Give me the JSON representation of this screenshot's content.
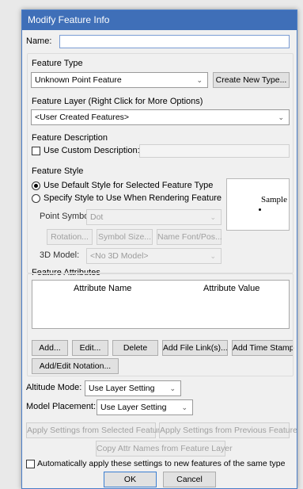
{
  "window": {
    "title": "Modify Feature Info"
  },
  "name": {
    "label": "Name:",
    "value": ""
  },
  "feature_type": {
    "heading": "Feature Type",
    "selected": "Unknown Point Feature",
    "create_button": "Create New Type..."
  },
  "feature_layer": {
    "heading": "Feature Layer (Right Click for More Options)",
    "selected": "<User Created Features>"
  },
  "feature_description": {
    "heading": "Feature Description",
    "checkbox_label": "Use Custom Description:",
    "value": ""
  },
  "feature_style": {
    "heading": "Feature Style",
    "radio_default": "Use Default Style for Selected Feature Type",
    "radio_specify": "Specify Style to Use When Rendering Feature",
    "point_symbol_label": "Point Symbol",
    "point_symbol_value": "Dot",
    "rotation_button": "Rotation...",
    "symbol_size_button": "Symbol Size...",
    "name_font_button": "Name Font/Pos...",
    "model_label": "3D Model:",
    "model_value": "<No 3D Model>",
    "sample_label": "Sample"
  },
  "feature_attributes": {
    "heading": "Feature Attributes",
    "columns": [
      "Attribute Name",
      "Attribute Value"
    ],
    "add_button": "Add...",
    "edit_button": "Edit...",
    "delete_button": "Delete",
    "file_link_button": "Add File Link(s)...",
    "time_stamp_button": "Add Time Stamp",
    "notation_button": "Add/Edit Notation..."
  },
  "altitude_mode": {
    "label": "Altitude Mode:",
    "value": "Use Layer Setting"
  },
  "model_placement": {
    "label": "Model Placement:",
    "value": "Use Layer Setting"
  },
  "bottom": {
    "apply_selected": "Apply Settings from Selected Feature",
    "apply_previous": "Apply Settings from Previous Feature",
    "copy_attr": "Copy Attr Names from Feature Layer",
    "auto_apply": "Automatically apply these settings to new features of the same type",
    "ok": "OK",
    "cancel": "Cancel"
  }
}
